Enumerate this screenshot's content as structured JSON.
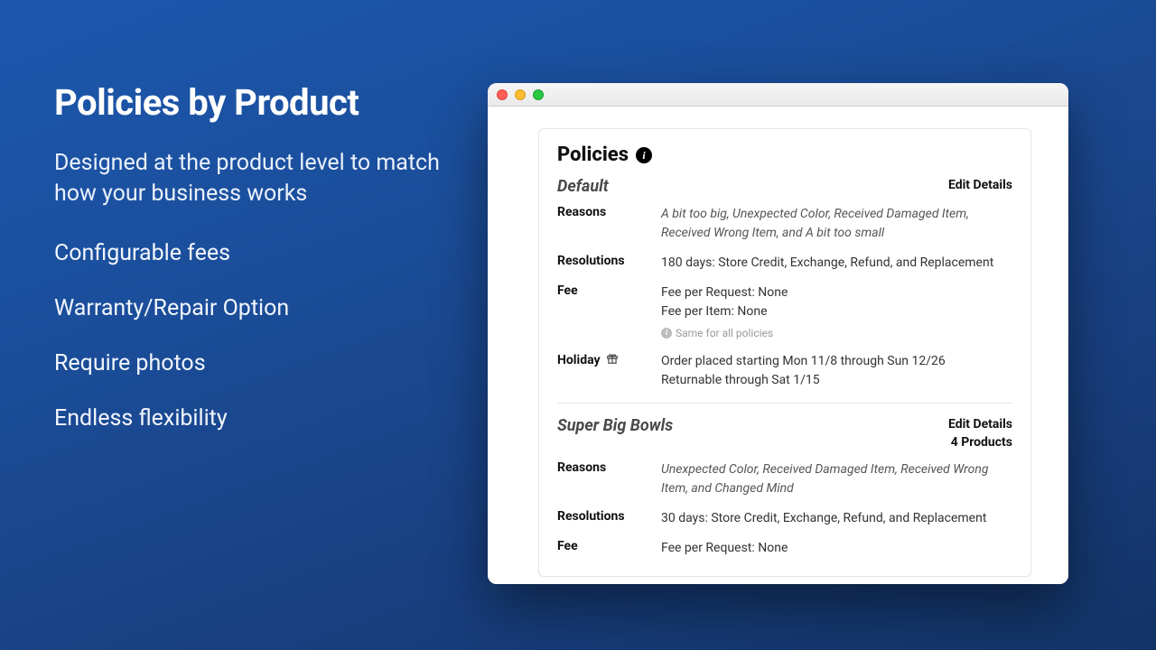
{
  "marketing": {
    "title": "Policies by Product",
    "subtitle": "Designed at the product level to match how your business works",
    "bullets": [
      "Configurable fees",
      "Warranty/Repair Option",
      "Require photos",
      "Endless flexibility"
    ]
  },
  "card": {
    "heading": "Policies",
    "policies": [
      {
        "name": "Default",
        "edit_label": "Edit Details",
        "product_count_label": "",
        "rows": {
          "reasons": {
            "label": "Reasons",
            "value_italic": "A bit too big, Unexpected Color, Received Damaged Item, Received Wrong Item, and A bit too small"
          },
          "resolutions": {
            "label": "Resolutions",
            "value": "180 days: Store Credit, Exchange, Refund, and Replacement"
          },
          "fee": {
            "label": "Fee",
            "line1": "Fee per Request: None",
            "line2": "Fee per Item: None",
            "hint": "Same for all policies"
          },
          "holiday": {
            "label": "Holiday",
            "line1": "Order placed starting Mon 11/8 through Sun 12/26",
            "line2": "Returnable through Sat 1/15"
          }
        }
      },
      {
        "name": "Super Big Bowls",
        "edit_label": "Edit Details",
        "product_count_label": "4 Products",
        "rows": {
          "reasons": {
            "label": "Reasons",
            "value_italic": "Unexpected Color, Received Damaged Item, Received Wrong Item, and Changed Mind"
          },
          "resolutions": {
            "label": "Resolutions",
            "value": "30 days: Store Credit, Exchange, Refund, and Replacement"
          },
          "fee": {
            "label": "Fee",
            "line1": "Fee per Request: None"
          }
        }
      }
    ]
  }
}
